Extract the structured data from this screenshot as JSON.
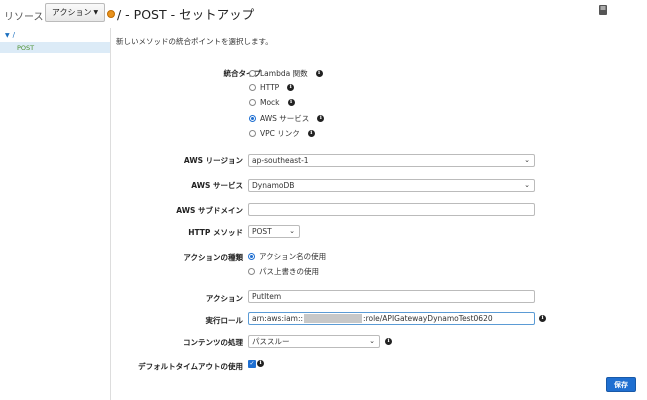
{
  "topbar": {
    "resources": "リソース",
    "action_button": "アクション",
    "page_title": "/ - POST - セットアップ"
  },
  "sidebar": {
    "root": "/",
    "post": "POST"
  },
  "intro": "新しいメソッドの統合ポイントを選択します。",
  "integration_type": {
    "label": "統合タイプ",
    "options": [
      "Lambda 関数",
      "HTTP",
      "Mock",
      "AWS サービス",
      "VPC リンク"
    ],
    "selected": "AWS サービス"
  },
  "aws_region": {
    "label": "AWS リージョン",
    "value": "ap-southeast-1"
  },
  "aws_service": {
    "label": "AWS サービス",
    "value": "DynamoDB"
  },
  "aws_subdomain": {
    "label": "AWS サブドメイン",
    "value": ""
  },
  "http_method": {
    "label": "HTTP メソッド",
    "value": "POST"
  },
  "action_type": {
    "label": "アクションの種類",
    "options": [
      "アクション名の使用",
      "パス上書きの使用"
    ],
    "selected": "アクション名の使用"
  },
  "action": {
    "label": "アクション",
    "value": "PutItem"
  },
  "execution_role": {
    "label": "実行ロール",
    "prefix": "arn:aws:iam::",
    "suffix": ":role/APIGatewayDynamoTest0620"
  },
  "content_handling": {
    "label": "コンテンツの処理",
    "value": "パススルー"
  },
  "default_timeout": {
    "label": "デフォルトタイムアウトの使用",
    "checked": true
  },
  "save_button": "保存",
  "colors": {
    "primary": "#1f6fd1",
    "tree_selected_bg": "#dcebf7",
    "post_text": "#4a8f2f",
    "status_dot": "#e8921c"
  }
}
